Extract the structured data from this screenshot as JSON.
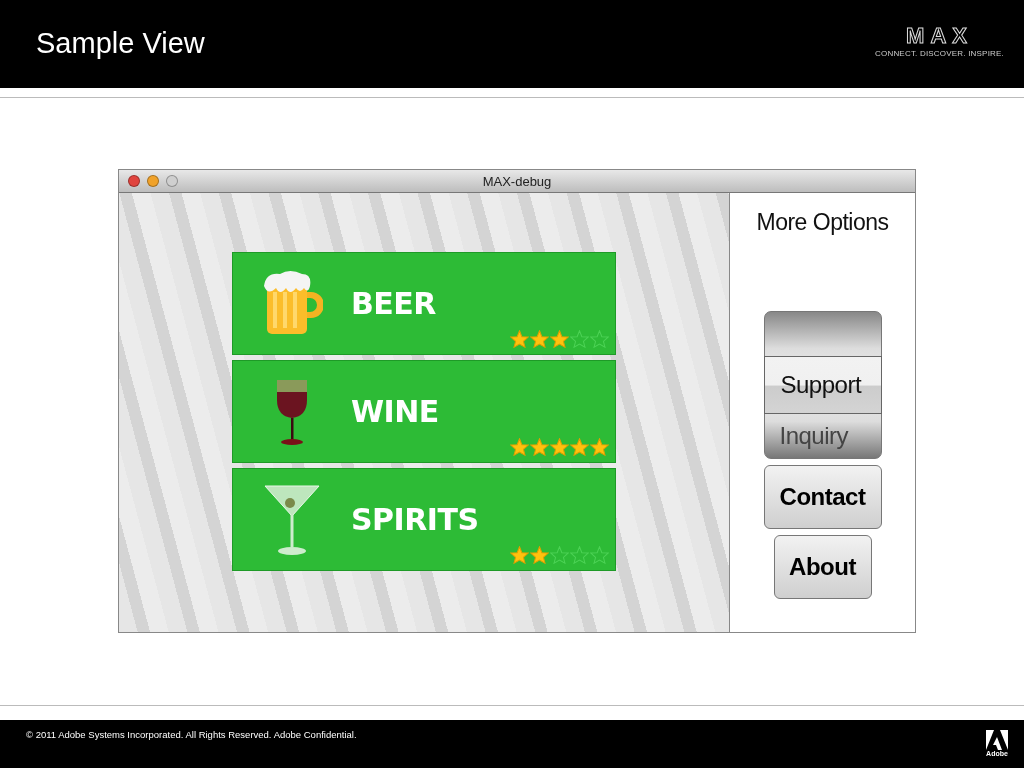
{
  "slide": {
    "title": "Sample View",
    "logo": {
      "wordmark": "MAX",
      "tagline": "CONNECT. DISCOVER. INSPIRE."
    }
  },
  "window": {
    "title": "MAX-debug"
  },
  "categories": [
    {
      "name": "BEER",
      "kind": "beer",
      "stars": 3
    },
    {
      "name": "WINE",
      "kind": "wine",
      "stars": 5
    },
    {
      "name": "SPIRITS",
      "kind": "spirits",
      "stars": 2
    }
  ],
  "side_panel": {
    "title": "More Options",
    "picker": [
      {
        "label": "Support",
        "selected": true
      },
      {
        "label": "Inquiry",
        "selected": false
      }
    ],
    "buttons": [
      "Contact",
      "About"
    ]
  },
  "footer": {
    "text": "© 2011 Adobe Systems Incorporated.  All Rights Reserved.  Adobe Confidential.",
    "brand": "Adobe"
  }
}
